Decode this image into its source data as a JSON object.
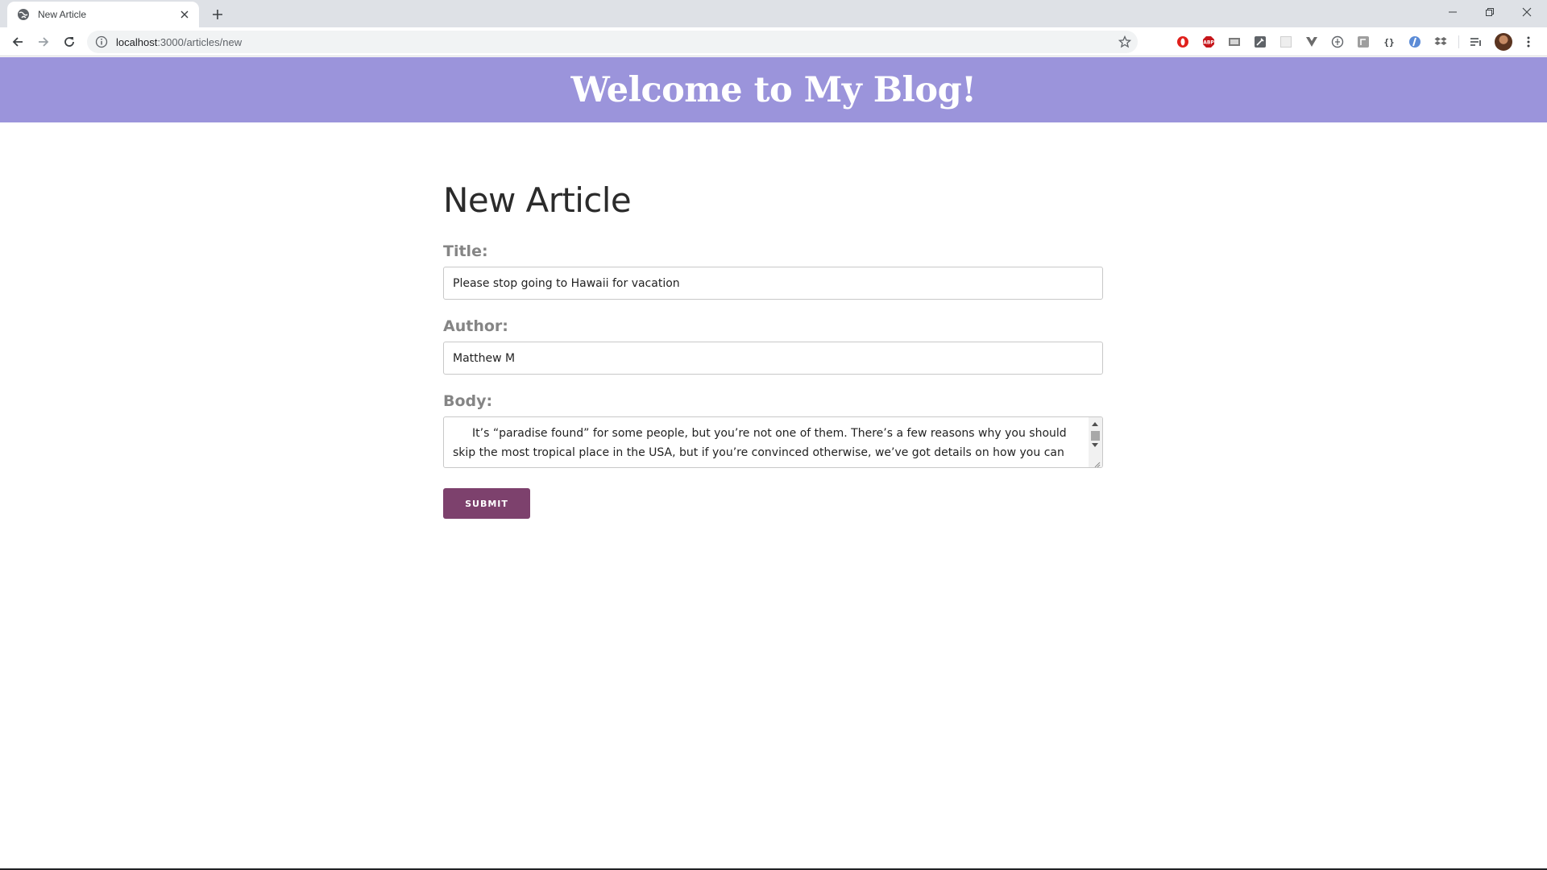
{
  "browser": {
    "tab_title": "New Article",
    "url_host": "localhost",
    "url_rest": ":3000/articles/new",
    "extensions": [
      "opera-icon",
      "adblock-plus-icon",
      "pdf-icon",
      "edit-icon",
      "blank-icon",
      "vue-devtools-icon",
      "globe-icon",
      "puzzle-icon",
      "code-braces-icon",
      "lastpass-icon",
      "dropbox-icon"
    ]
  },
  "site": {
    "header_title": "Welcome to My Blog!"
  },
  "form": {
    "heading": "New Article",
    "title_label": "Title:",
    "title_value": "Please stop going to Hawaii for vacation",
    "author_label": "Author:",
    "author_value": "Matthew M",
    "body_label": "Body:",
    "body_value": "It’s “paradise found” for some people, but you’re not one of them. There’s a few reasons why you should skip the most tropical place in the USA, but if you’re convinced otherwise, we’ve got details on how you can",
    "submit_label": "SUBMIT"
  },
  "colors": {
    "header_bg": "#9b94db",
    "submit_bg": "#7d416d",
    "label_color": "#858585"
  }
}
